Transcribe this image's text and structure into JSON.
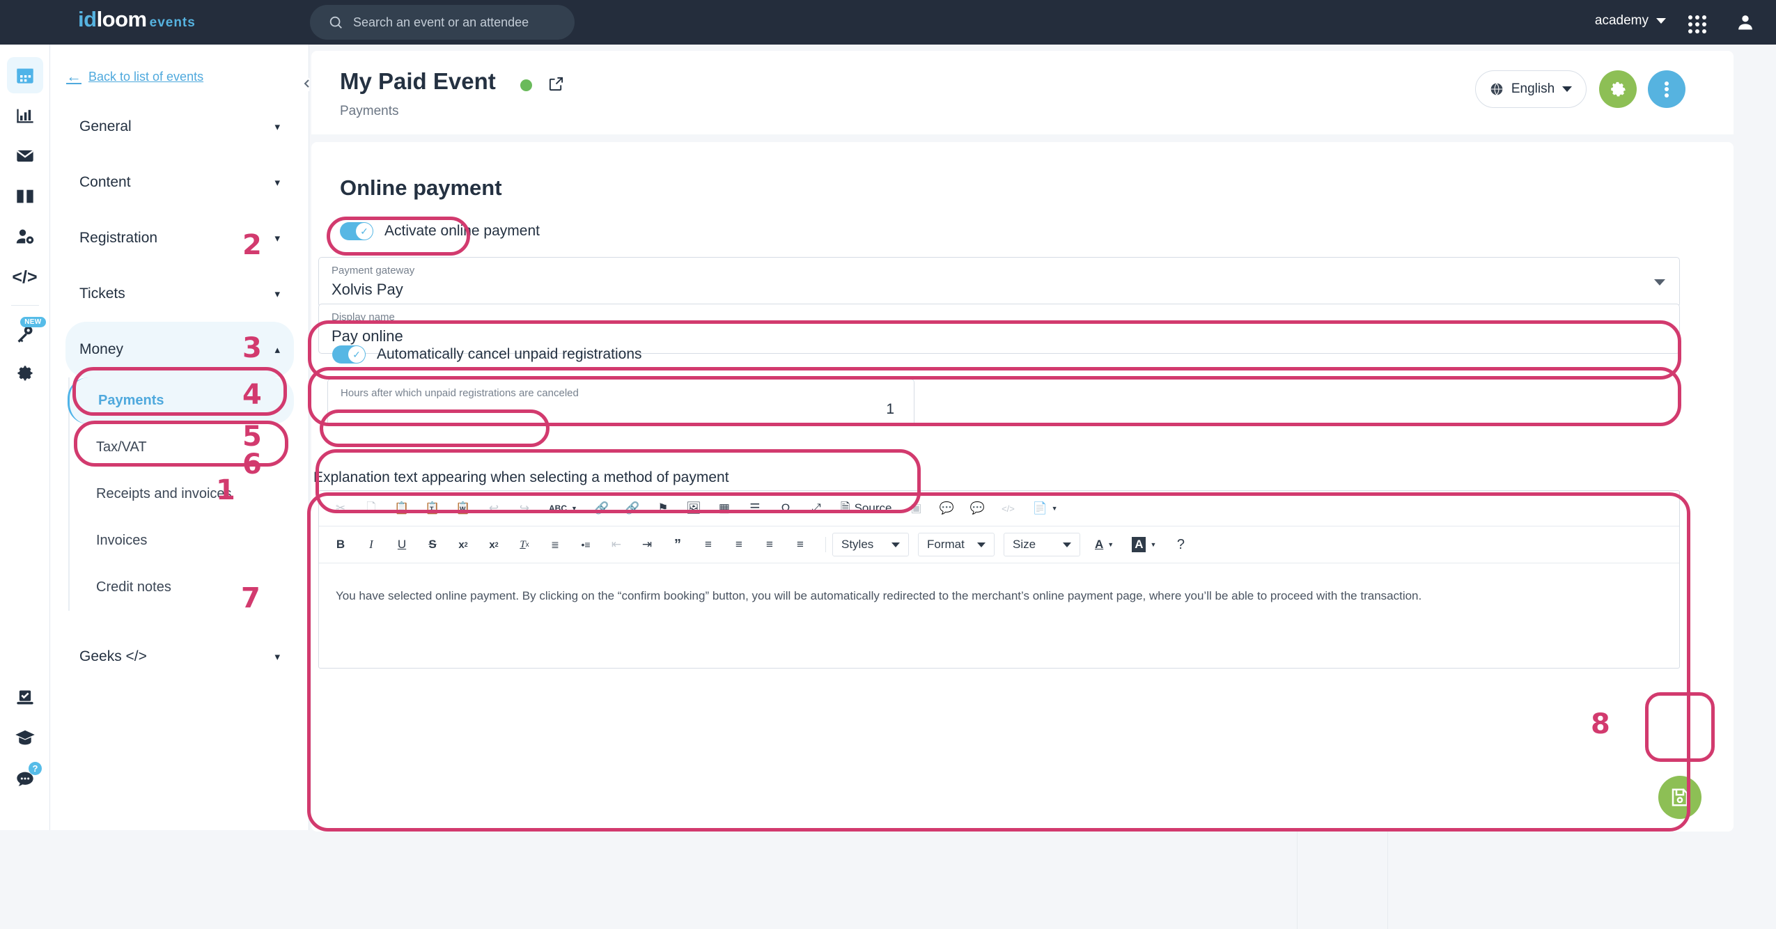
{
  "topbar": {
    "logo": {
      "part1": "id",
      "part2": "loom",
      "part3": "events"
    },
    "search_placeholder": "Search an event or an attendee",
    "account": "academy",
    "icons": {
      "search": "search-icon",
      "apps": "apps-grid-icon",
      "user": "user-avatar-icon",
      "caret": "chevron-down-icon"
    }
  },
  "rail": {
    "items": [
      {
        "name": "calendar-icon",
        "active": true,
        "badge": ""
      },
      {
        "name": "analytics-icon",
        "active": false,
        "badge": ""
      },
      {
        "name": "mail-icon",
        "active": false,
        "badge": ""
      },
      {
        "name": "book-icon",
        "active": false,
        "badge": ""
      },
      {
        "name": "user-settings-icon",
        "active": false,
        "badge": ""
      },
      {
        "name": "code-icon",
        "active": false,
        "badge": ""
      },
      {
        "name": "key-icon",
        "active": false,
        "badge": "NEW"
      },
      {
        "name": "gear-icon",
        "active": false,
        "badge": ""
      }
    ],
    "bottom_items": [
      {
        "name": "tasks-icon",
        "badge": ""
      },
      {
        "name": "academy-icon",
        "badge": ""
      },
      {
        "name": "support-chat-icon",
        "badge": "?"
      }
    ]
  },
  "sidebar": {
    "back_label": "Back to list of events",
    "nav": [
      {
        "label": "General",
        "state": "collapsed"
      },
      {
        "label": "Content",
        "state": "collapsed"
      },
      {
        "label": "Registration",
        "state": "collapsed"
      },
      {
        "label": "Tickets",
        "state": "collapsed"
      },
      {
        "label": "Money",
        "state": "expanded"
      }
    ],
    "money_children": [
      {
        "label": "Payments",
        "active": true
      },
      {
        "label": "Tax/VAT",
        "active": false
      },
      {
        "label": "Receipts and invoices",
        "active": false
      },
      {
        "label": "Invoices",
        "active": false
      },
      {
        "label": "Credit notes",
        "active": false
      }
    ],
    "nav_after": [
      {
        "label": "Geeks </>",
        "state": "collapsed"
      }
    ]
  },
  "page": {
    "title": "My Paid Event",
    "status_color": "#6aba5b",
    "subtitle": "Payments",
    "language": "English",
    "section_title": "Online payment"
  },
  "form": {
    "activate_toggle": {
      "label": "Activate online payment",
      "on": true
    },
    "payment_gateway": {
      "label": "Payment gateway",
      "value": "Xolvis Pay"
    },
    "display_name": {
      "label": "Display name",
      "value": "Pay online"
    },
    "auto_cancel_toggle": {
      "label": "Automatically cancel unpaid registrations",
      "on": true
    },
    "hours_field": {
      "label": "Hours after which unpaid registrations are canceled",
      "value": "1"
    },
    "explanation_label": "Explanation text appearing when selecting a method of payment",
    "explanation_text": "You have selected online payment. By clicking on the “confirm booking” button, you will be automatically redirected to the merchant’s online payment page, where you’ll be able to proceed with the transaction."
  },
  "editor_toolbar": {
    "row1": [
      {
        "name": "cut-icon",
        "glyph": "✂",
        "dim": true
      },
      {
        "name": "copy-icon",
        "glyph": "❐",
        "dim": true
      },
      {
        "name": "paste-icon",
        "glyph": "ὌB",
        "dim": false
      },
      {
        "name": "paste-text-icon",
        "glyph": "T",
        "dim": false
      },
      {
        "name": "paste-word-icon",
        "glyph": "W",
        "dim": false
      },
      {
        "name": "undo-icon",
        "glyph": "↶",
        "dim": true
      },
      {
        "name": "redo-icon",
        "glyph": "↷",
        "dim": true
      },
      {
        "name": "spellcheck-icon",
        "glyph": "ABC",
        "dim": false
      },
      {
        "name": "link-icon",
        "glyph": "ὑ7",
        "dim": false
      },
      {
        "name": "unlink-icon",
        "glyph": "ὑ7",
        "dim": true
      },
      {
        "name": "anchor-flag-icon",
        "glyph": "⚑",
        "dim": false
      },
      {
        "name": "image-icon",
        "glyph": "ὛC",
        "dim": false
      },
      {
        "name": "table-icon",
        "glyph": "▦",
        "dim": false
      },
      {
        "name": "horizontal-rule-icon",
        "glyph": "☰",
        "dim": false
      },
      {
        "name": "special-char-icon",
        "glyph": "Ω",
        "dim": false
      },
      {
        "name": "maximize-icon",
        "glyph": "⤢",
        "dim": false
      },
      {
        "name": "source-button",
        "glyph": "Source",
        "dim": false
      },
      {
        "name": "show-blocks-icon",
        "glyph": "▣",
        "dim": true
      },
      {
        "name": "comment-icon",
        "glyph": "ὊC",
        "dim": false
      },
      {
        "name": "no-comment-icon",
        "glyph": "ὊC",
        "dim": true
      },
      {
        "name": "code-snippet-icon",
        "glyph": "</>",
        "dim": true
      },
      {
        "name": "templates-icon",
        "glyph": "Ὄ4",
        "dim": false
      }
    ],
    "row2": [
      {
        "name": "bold-icon",
        "glyph": "B",
        "dim": false
      },
      {
        "name": "italic-icon",
        "glyph": "I",
        "dim": false
      },
      {
        "name": "underline-icon",
        "glyph": "U",
        "dim": false
      },
      {
        "name": "strikethrough-icon",
        "glyph": "S",
        "dim": false
      },
      {
        "name": "subscript-icon",
        "glyph": "x₂",
        "dim": false
      },
      {
        "name": "superscript-icon",
        "glyph": "x²",
        "dim": false
      },
      {
        "name": "remove-format-icon",
        "glyph": "Tₓ",
        "dim": false
      },
      {
        "name": "numbered-list-icon",
        "glyph": "≣",
        "dim": false
      },
      {
        "name": "bulleted-list-icon",
        "glyph": "•≡",
        "dim": false
      },
      {
        "name": "outdent-icon",
        "glyph": "⇤",
        "dim": true
      },
      {
        "name": "indent-icon",
        "glyph": "⇥",
        "dim": false
      },
      {
        "name": "blockquote-icon",
        "glyph": "”",
        "dim": false
      },
      {
        "name": "align-left-icon",
        "glyph": "≡",
        "dim": false
      },
      {
        "name": "align-center-icon",
        "glyph": "≡",
        "dim": false
      },
      {
        "name": "align-right-icon",
        "glyph": "≡",
        "dim": false
      },
      {
        "name": "justify-icon",
        "glyph": "≡",
        "dim": false
      }
    ],
    "selects": [
      {
        "name": "styles-select",
        "label": "Styles"
      },
      {
        "name": "format-select",
        "label": "Format"
      },
      {
        "name": "size-select",
        "label": "Size"
      }
    ],
    "row2_end": [
      {
        "name": "text-color-icon",
        "glyph": "A",
        "dim": false
      },
      {
        "name": "background-color-icon",
        "glyph": "A",
        "dim": false
      },
      {
        "name": "about-help-icon",
        "glyph": "?",
        "dim": false
      }
    ]
  },
  "annotations": {
    "color": "#d23a6e",
    "steps": [
      {
        "num": "1",
        "target": "money-payments-nav"
      },
      {
        "num": "2",
        "target": "activate-online-payment-toggle"
      },
      {
        "num": "3",
        "target": "payment-gateway-select"
      },
      {
        "num": "4",
        "target": "display-name-field"
      },
      {
        "num": "5",
        "target": "auto-cancel-toggle"
      },
      {
        "num": "6",
        "target": "hours-field"
      },
      {
        "num": "7",
        "target": "explanation-editor"
      },
      {
        "num": "8",
        "target": "save-button"
      }
    ]
  },
  "save_button": {
    "name": "save-button",
    "icon": "floppy-disk-icon",
    "color": "#8dbf55"
  }
}
